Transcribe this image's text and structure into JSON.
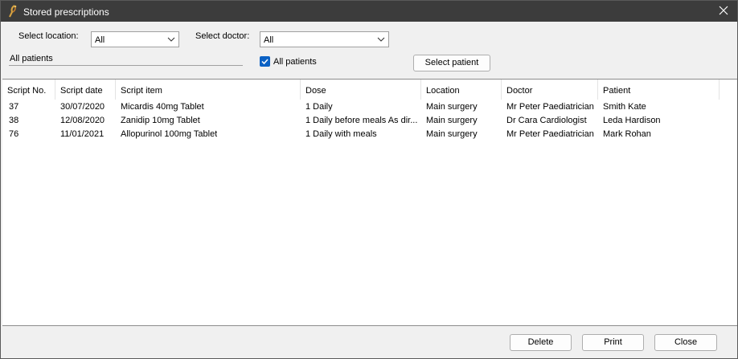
{
  "window": {
    "title": "Stored prescriptions"
  },
  "filters": {
    "location_label": "Select location:",
    "location_value": "All",
    "doctor_label": "Select doctor:",
    "doctor_value": "All",
    "patient_field": "All patients",
    "all_patients_checkbox": {
      "label": "All patients",
      "checked": true
    },
    "select_patient_button": "Select patient"
  },
  "table": {
    "columns": [
      "Script No.",
      "Script date",
      "Script item",
      "Dose",
      "Location",
      "Doctor",
      "Patient"
    ],
    "rows": [
      [
        "37",
        "30/07/2020",
        "Micardis 40mg Tablet",
        "1 Daily",
        "Main surgery",
        "Mr Peter Paediatrician",
        "Smith Kate"
      ],
      [
        "38",
        "12/08/2020",
        "Zanidip 10mg Tablet",
        "1 Daily before meals As dir...",
        "Main surgery",
        "Dr Cara Cardiologist",
        "Leda Hardison"
      ],
      [
        "76",
        "11/01/2021",
        "Allopurinol 100mg Tablet",
        "1 Daily with meals",
        "Main surgery",
        "Mr Peter Paediatrician",
        "Mark Rohan"
      ]
    ]
  },
  "footer": {
    "delete_label": "Delete",
    "print_label": "Print",
    "close_label": "Close"
  },
  "colors": {
    "titlebar": "#3c3c3c",
    "accent": "#0b61c4"
  }
}
